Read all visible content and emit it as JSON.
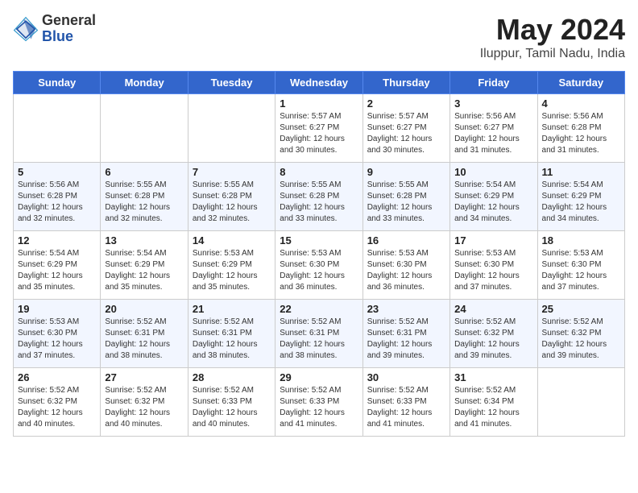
{
  "header": {
    "logo_general": "General",
    "logo_blue": "Blue",
    "month_title": "May 2024",
    "location": "Iluppur, Tamil Nadu, India"
  },
  "days_of_week": [
    "Sunday",
    "Monday",
    "Tuesday",
    "Wednesday",
    "Thursday",
    "Friday",
    "Saturday"
  ],
  "weeks": [
    [
      {
        "day": "",
        "info": ""
      },
      {
        "day": "",
        "info": ""
      },
      {
        "day": "",
        "info": ""
      },
      {
        "day": "1",
        "info": "Sunrise: 5:57 AM\nSunset: 6:27 PM\nDaylight: 12 hours\nand 30 minutes."
      },
      {
        "day": "2",
        "info": "Sunrise: 5:57 AM\nSunset: 6:27 PM\nDaylight: 12 hours\nand 30 minutes."
      },
      {
        "day": "3",
        "info": "Sunrise: 5:56 AM\nSunset: 6:27 PM\nDaylight: 12 hours\nand 31 minutes."
      },
      {
        "day": "4",
        "info": "Sunrise: 5:56 AM\nSunset: 6:28 PM\nDaylight: 12 hours\nand 31 minutes."
      }
    ],
    [
      {
        "day": "5",
        "info": "Sunrise: 5:56 AM\nSunset: 6:28 PM\nDaylight: 12 hours\nand 32 minutes."
      },
      {
        "day": "6",
        "info": "Sunrise: 5:55 AM\nSunset: 6:28 PM\nDaylight: 12 hours\nand 32 minutes."
      },
      {
        "day": "7",
        "info": "Sunrise: 5:55 AM\nSunset: 6:28 PM\nDaylight: 12 hours\nand 32 minutes."
      },
      {
        "day": "8",
        "info": "Sunrise: 5:55 AM\nSunset: 6:28 PM\nDaylight: 12 hours\nand 33 minutes."
      },
      {
        "day": "9",
        "info": "Sunrise: 5:55 AM\nSunset: 6:28 PM\nDaylight: 12 hours\nand 33 minutes."
      },
      {
        "day": "10",
        "info": "Sunrise: 5:54 AM\nSunset: 6:29 PM\nDaylight: 12 hours\nand 34 minutes."
      },
      {
        "day": "11",
        "info": "Sunrise: 5:54 AM\nSunset: 6:29 PM\nDaylight: 12 hours\nand 34 minutes."
      }
    ],
    [
      {
        "day": "12",
        "info": "Sunrise: 5:54 AM\nSunset: 6:29 PM\nDaylight: 12 hours\nand 35 minutes."
      },
      {
        "day": "13",
        "info": "Sunrise: 5:54 AM\nSunset: 6:29 PM\nDaylight: 12 hours\nand 35 minutes."
      },
      {
        "day": "14",
        "info": "Sunrise: 5:53 AM\nSunset: 6:29 PM\nDaylight: 12 hours\nand 35 minutes."
      },
      {
        "day": "15",
        "info": "Sunrise: 5:53 AM\nSunset: 6:30 PM\nDaylight: 12 hours\nand 36 minutes."
      },
      {
        "day": "16",
        "info": "Sunrise: 5:53 AM\nSunset: 6:30 PM\nDaylight: 12 hours\nand 36 minutes."
      },
      {
        "day": "17",
        "info": "Sunrise: 5:53 AM\nSunset: 6:30 PM\nDaylight: 12 hours\nand 37 minutes."
      },
      {
        "day": "18",
        "info": "Sunrise: 5:53 AM\nSunset: 6:30 PM\nDaylight: 12 hours\nand 37 minutes."
      }
    ],
    [
      {
        "day": "19",
        "info": "Sunrise: 5:53 AM\nSunset: 6:30 PM\nDaylight: 12 hours\nand 37 minutes."
      },
      {
        "day": "20",
        "info": "Sunrise: 5:52 AM\nSunset: 6:31 PM\nDaylight: 12 hours\nand 38 minutes."
      },
      {
        "day": "21",
        "info": "Sunrise: 5:52 AM\nSunset: 6:31 PM\nDaylight: 12 hours\nand 38 minutes."
      },
      {
        "day": "22",
        "info": "Sunrise: 5:52 AM\nSunset: 6:31 PM\nDaylight: 12 hours\nand 38 minutes."
      },
      {
        "day": "23",
        "info": "Sunrise: 5:52 AM\nSunset: 6:31 PM\nDaylight: 12 hours\nand 39 minutes."
      },
      {
        "day": "24",
        "info": "Sunrise: 5:52 AM\nSunset: 6:32 PM\nDaylight: 12 hours\nand 39 minutes."
      },
      {
        "day": "25",
        "info": "Sunrise: 5:52 AM\nSunset: 6:32 PM\nDaylight: 12 hours\nand 39 minutes."
      }
    ],
    [
      {
        "day": "26",
        "info": "Sunrise: 5:52 AM\nSunset: 6:32 PM\nDaylight: 12 hours\nand 40 minutes."
      },
      {
        "day": "27",
        "info": "Sunrise: 5:52 AM\nSunset: 6:32 PM\nDaylight: 12 hours\nand 40 minutes."
      },
      {
        "day": "28",
        "info": "Sunrise: 5:52 AM\nSunset: 6:33 PM\nDaylight: 12 hours\nand 40 minutes."
      },
      {
        "day": "29",
        "info": "Sunrise: 5:52 AM\nSunset: 6:33 PM\nDaylight: 12 hours\nand 41 minutes."
      },
      {
        "day": "30",
        "info": "Sunrise: 5:52 AM\nSunset: 6:33 PM\nDaylight: 12 hours\nand 41 minutes."
      },
      {
        "day": "31",
        "info": "Sunrise: 5:52 AM\nSunset: 6:34 PM\nDaylight: 12 hours\nand 41 minutes."
      },
      {
        "day": "",
        "info": ""
      }
    ]
  ]
}
